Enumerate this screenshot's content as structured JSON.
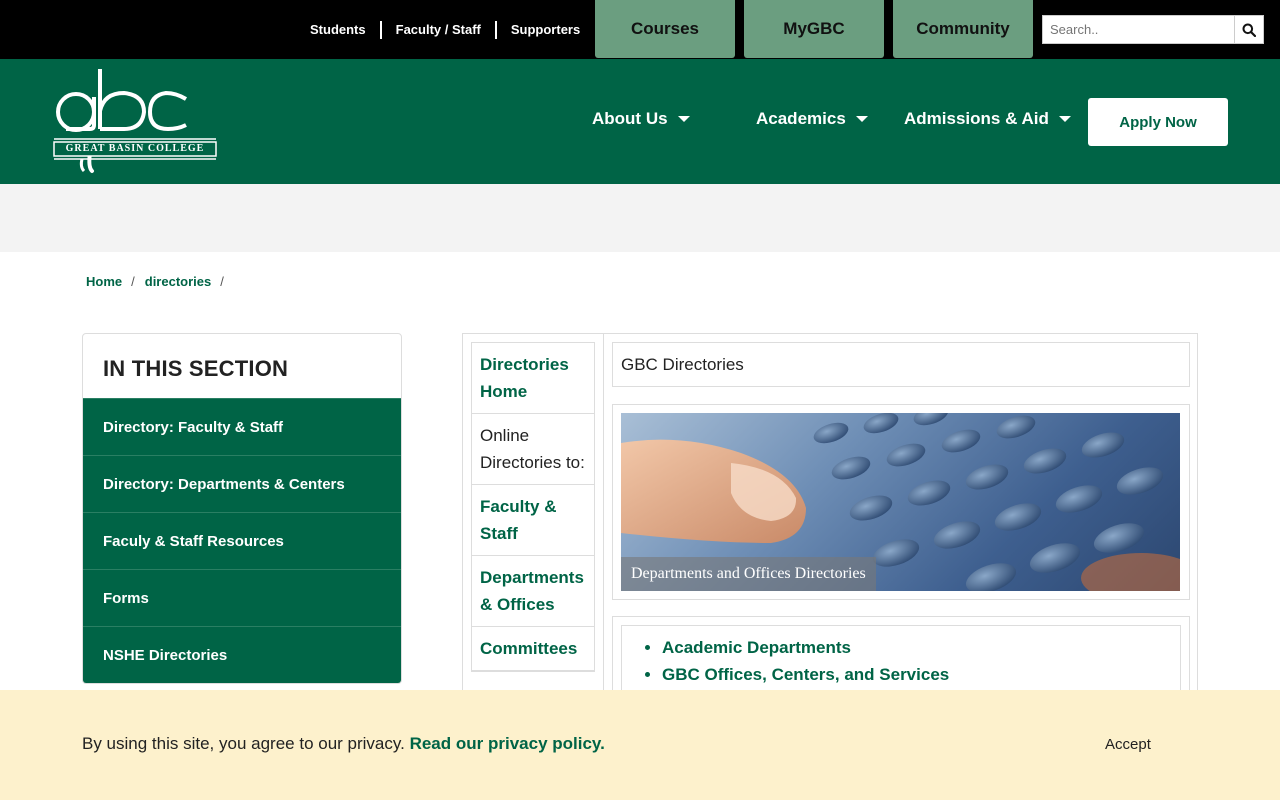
{
  "topbar": {
    "links": [
      "Students",
      "Faculty / Staff",
      "Supporters"
    ],
    "tabs": [
      "Courses",
      "MyGBC",
      "Community"
    ],
    "search_placeholder": "Search.."
  },
  "header": {
    "logo_text": "GREAT BASIN COLLEGE",
    "nav": [
      "About Us",
      "Academics",
      "Admissions & Aid"
    ],
    "apply_label": "Apply Now"
  },
  "breadcrumb": [
    "Home",
    "directories"
  ],
  "sidebar": {
    "title": "IN THIS SECTION",
    "items": [
      "Directory: Faculty & Staff",
      "Directory: Departments & Centers",
      "Faculy & Staff Resources",
      "Forms",
      "NSHE Directories"
    ]
  },
  "main": {
    "leftnav": [
      {
        "label": "Directories Home",
        "link": true
      },
      {
        "label": "Online Directories to:",
        "link": false
      },
      {
        "label": "Faculty & Staff",
        "link": true
      },
      {
        "label": "Departments & Offices",
        "link": true
      },
      {
        "label": "Committees",
        "link": true
      }
    ],
    "title": "GBC Directories",
    "hero_caption": "Departments and Offices Directories",
    "links": [
      "Academic Departments",
      "GBC Offices, Centers, and Services"
    ]
  },
  "cookie": {
    "text": "By using this site, you agree to our privacy.",
    "link": "Read our privacy policy.",
    "accept": "Accept"
  },
  "colors": {
    "brand_green": "#006446",
    "tab_green": "#6b9e80",
    "cookie_bg": "#fdf1cc"
  }
}
